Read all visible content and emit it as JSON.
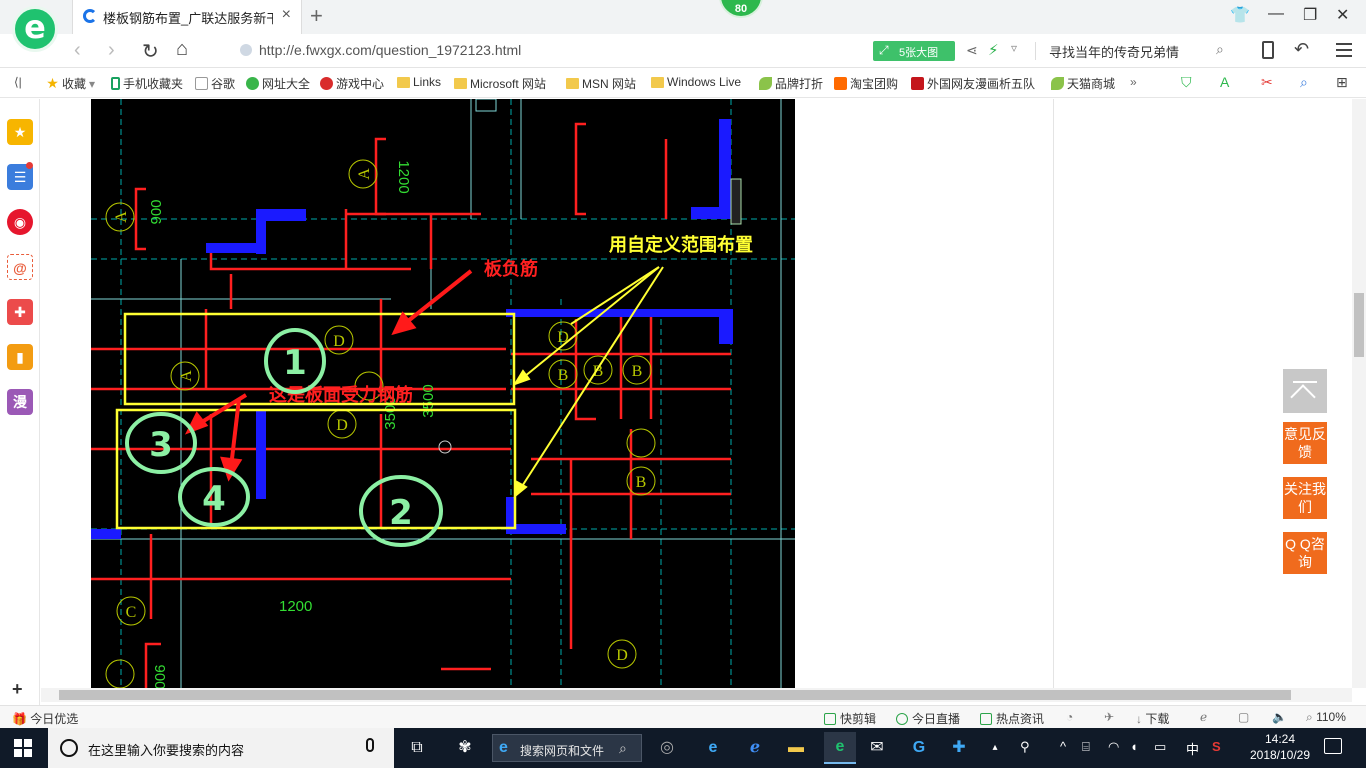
{
  "browser": {
    "badge": "80",
    "tab": {
      "title": "楼板钢筋布置_广联达服务新干线"
    },
    "address": {
      "url": "http://e.fwxgx.com/question_1972123.html",
      "big_image_label": "5张大图",
      "search_text": "寻找当年的传奇兄弟情"
    },
    "bookmarks": [
      {
        "label": "收藏",
        "icon": "star-icon"
      },
      {
        "label": "手机收藏夹",
        "icon": "phone-icon"
      },
      {
        "label": "谷歌",
        "icon": "page-icon"
      },
      {
        "label": "网址大全",
        "icon": "globe-icon"
      },
      {
        "label": "游戏中心",
        "icon": "game-icon"
      },
      {
        "label": "Links",
        "icon": "folder-icon"
      },
      {
        "label": "Microsoft 网站",
        "icon": "folder-icon"
      },
      {
        "label": "MSN 网站",
        "icon": "folder-icon"
      },
      {
        "label": "Windows Live",
        "icon": "folder-icon"
      },
      {
        "label": "品牌打折",
        "icon": "leaf-icon"
      },
      {
        "label": "淘宝团购",
        "icon": "taobao-icon"
      },
      {
        "label": "外国网友漫画析五队",
        "icon": "bookmark-icon"
      },
      {
        "label": "天猫商城",
        "icon": "leaf-icon"
      }
    ],
    "sidebar": [
      {
        "name": "favorites",
        "icon": "star-icon",
        "color": "#f7b500"
      },
      {
        "name": "reader",
        "icon": "list-icon",
        "color": "#3b7ddd"
      },
      {
        "name": "weibo",
        "icon": "weibo-icon",
        "color": "#e6162d"
      },
      {
        "name": "mail",
        "icon": "mail-icon",
        "color": "#e95c3a"
      },
      {
        "name": "games",
        "icon": "gamepad-icon",
        "color": "#ec4b4b"
      },
      {
        "name": "books",
        "icon": "book-icon",
        "color": "#f39c12"
      },
      {
        "name": "comics",
        "icon": "comic-icon",
        "label": "漫",
        "color": "#9b59b6"
      }
    ],
    "float_buttons": [
      {
        "name": "feedback",
        "label": "意见反馈"
      },
      {
        "name": "follow",
        "label": "关注我们"
      },
      {
        "name": "qq",
        "label": "Q Q咨询"
      }
    ],
    "cad": {
      "dims": [
        "900",
        "1200",
        "1200",
        "3500",
        "900",
        "3500"
      ],
      "labels_D": [
        "D",
        "D",
        "D",
        "D"
      ],
      "labels_B": [
        "B",
        "B",
        "B",
        "B"
      ],
      "labels_A": [
        "A",
        "A",
        "A"
      ],
      "label_C": "C",
      "annot_neg": "板负筋",
      "annot_custom": "用自定义范围布置",
      "annot_stress": "这是板面受力钢筋",
      "hand_numbers": [
        "1",
        "2",
        "3",
        "4"
      ]
    },
    "status": {
      "left": "今日优选",
      "items": [
        "快剪辑",
        "今日直播",
        "热点资讯",
        "下载"
      ],
      "zoom": "110%"
    }
  },
  "taskbar": {
    "search_placeholder": "在这里输入你要搜索的内容",
    "web_search": "搜索网页和文件",
    "ime": "中",
    "time": "14:24",
    "date": "2018/10/29"
  },
  "colors": {
    "accent_green": "#1fc26f",
    "orange": "#f06b1d",
    "cad_red": "#ff2020",
    "cad_yellow": "#ffff33",
    "cad_blue": "#1a1aff",
    "hand_green": "#8cf0a4"
  }
}
